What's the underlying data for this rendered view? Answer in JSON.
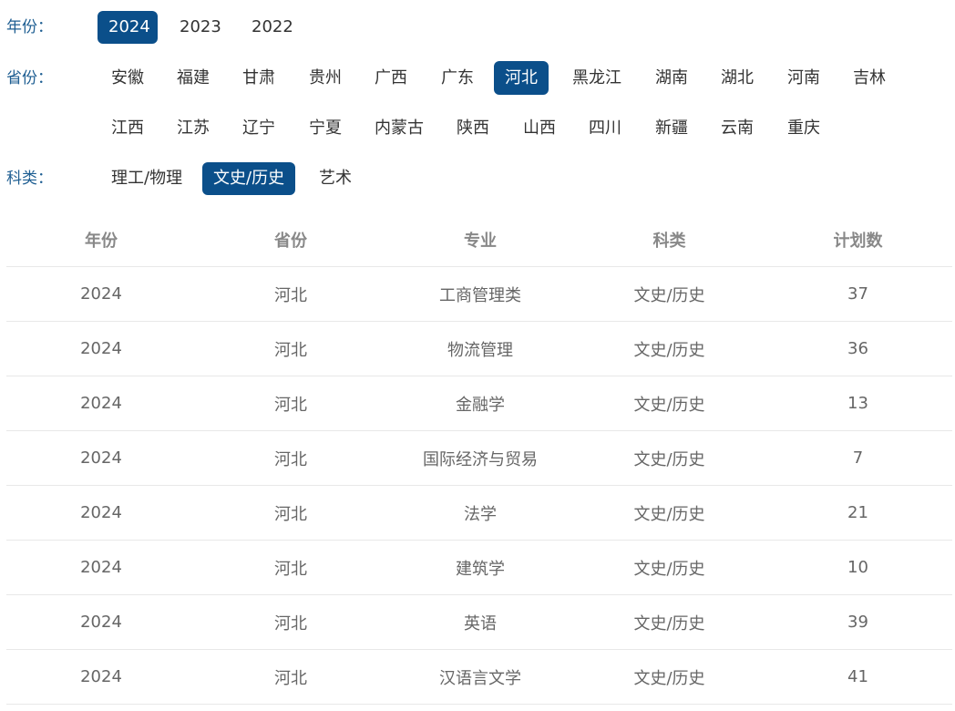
{
  "filters": {
    "year": {
      "label": "年份：",
      "options": [
        "2024",
        "2023",
        "2022"
      ],
      "selected": "2024"
    },
    "province": {
      "label": "省份：",
      "row1": [
        "安徽",
        "福建",
        "甘肃",
        "贵州",
        "广西",
        "广东",
        "河北",
        "黑龙江",
        "湖南",
        "湖北",
        "河南",
        "吉林"
      ],
      "row2": [
        "江西",
        "江苏",
        "辽宁",
        "宁夏",
        "内蒙古",
        "陕西",
        "山西",
        "四川",
        "新疆",
        "云南",
        "重庆"
      ],
      "selected": "河北"
    },
    "category": {
      "label": "科类：",
      "options": [
        "理工/物理",
        "文史/历史",
        "艺术"
      ],
      "selected": "文史/历史"
    }
  },
  "table": {
    "headers": [
      "年份",
      "省份",
      "专业",
      "科类",
      "计划数"
    ],
    "rows": [
      [
        "2024",
        "河北",
        "工商管理类",
        "文史/历史",
        "37"
      ],
      [
        "2024",
        "河北",
        "物流管理",
        "文史/历史",
        "36"
      ],
      [
        "2024",
        "河北",
        "金融学",
        "文史/历史",
        "13"
      ],
      [
        "2024",
        "河北",
        "国际经济与贸易",
        "文史/历史",
        "7"
      ],
      [
        "2024",
        "河北",
        "法学",
        "文史/历史",
        "21"
      ],
      [
        "2024",
        "河北",
        "建筑学",
        "文史/历史",
        "10"
      ],
      [
        "2024",
        "河北",
        "英语",
        "文史/历史",
        "39"
      ],
      [
        "2024",
        "河北",
        "汉语言文学",
        "文史/历史",
        "41"
      ]
    ]
  },
  "colors": {
    "accent": "#0b4f8a",
    "label": "#1e5e92",
    "header_text": "#888888",
    "cell_text": "#666666",
    "divider": "#e8e8e8"
  }
}
